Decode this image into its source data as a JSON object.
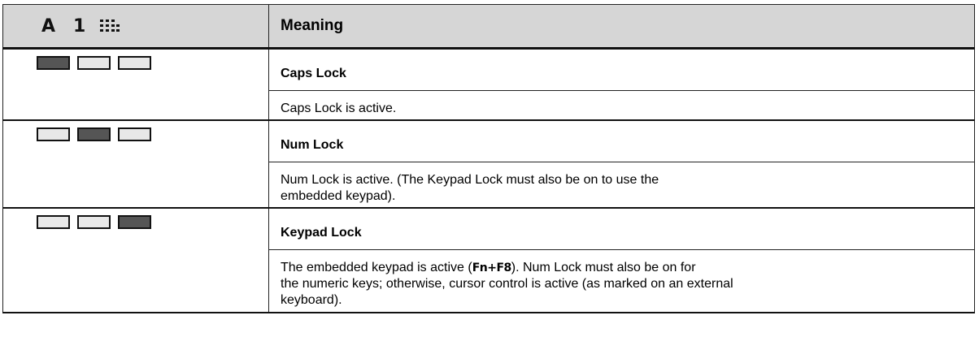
{
  "header": {
    "indicator_a": "A",
    "indicator_1": "1",
    "indicator_keypad_icon": "keypad-grid-icon",
    "meaning": "Meaning"
  },
  "led_colors": {
    "on": "#555555",
    "off": "#e8e8e8"
  },
  "rows": [
    {
      "leds": [
        "on",
        "off",
        "off"
      ],
      "title": "Caps Lock",
      "description": "Caps Lock is active."
    },
    {
      "leds": [
        "off",
        "on",
        "off"
      ],
      "title": "Num Lock",
      "description_line1": "Num Lock is active. (The Keypad Lock must also be on to use the",
      "description_line2": "embedded keypad)."
    },
    {
      "leds": [
        "off",
        "off",
        "on"
      ],
      "title": "Keypad Lock",
      "description_prefix": "The embedded keypad is active (",
      "shortcut": "Fn+F8",
      "description_suffix": "). Num Lock must also be on for",
      "description_line2": "the numeric keys; otherwise, cursor control is active (as marked on an external",
      "description_line3": "keyboard)."
    }
  ]
}
